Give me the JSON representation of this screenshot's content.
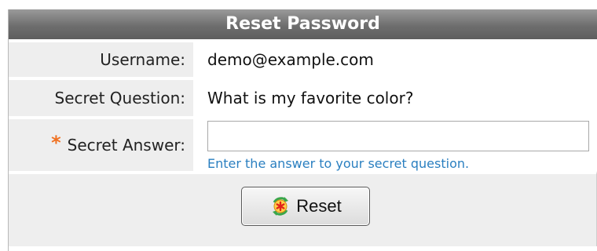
{
  "form": {
    "title": "Reset Password",
    "username": {
      "label": "Username:",
      "value": "demo@example.com"
    },
    "secret_question": {
      "label": "Secret Question:",
      "value": "What is my favorite color?"
    },
    "secret_answer": {
      "required_marker": "*",
      "label": "Secret Answer:",
      "value": "",
      "hint": "Enter the answer to your secret question."
    },
    "reset_button": {
      "label": "Reset",
      "icon": "reset-icon"
    }
  },
  "colors": {
    "title_bar": "#6e6e6e",
    "label_bg": "#eeeeee",
    "required": "#f07020",
    "hint": "#2a7fc0"
  }
}
